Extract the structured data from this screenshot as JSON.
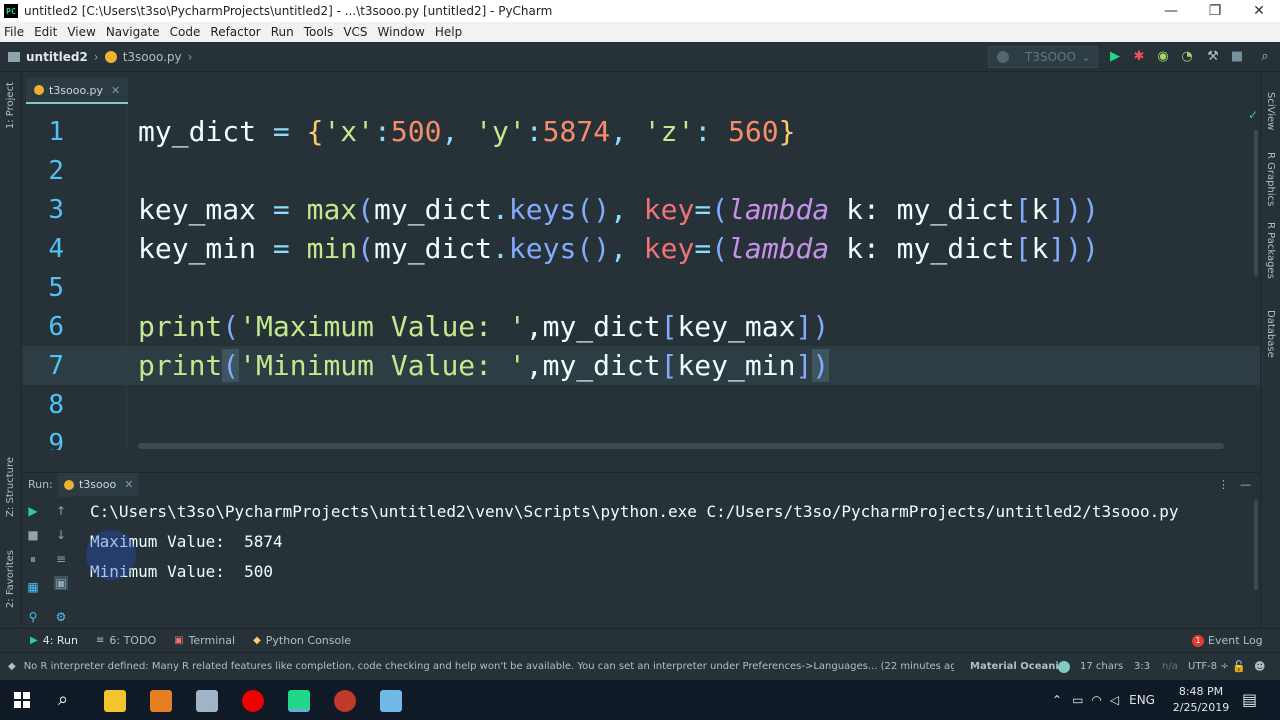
{
  "window": {
    "title": "untitled2 [C:\\Users\\t3so\\PycharmProjects\\untitled2] - ...\\t3sooo.py [untitled2] - PyCharm",
    "logo": "PC",
    "minimize": "—",
    "maximize": "❐",
    "close": "✕"
  },
  "menu": [
    "File",
    "Edit",
    "View",
    "Navigate",
    "Code",
    "Refactor",
    "Run",
    "Tools",
    "VCS",
    "Window",
    "Help"
  ],
  "breadcrumb": {
    "project": "untitled2",
    "file": "t3sooo.py",
    "arrow": "›"
  },
  "run_config": {
    "name": "T3SOOO",
    "dropdown": "⌄"
  },
  "side_labels": {
    "project": "1: Project",
    "structure": "Z: Structure",
    "favorites": "2: Favorites"
  },
  "right_labels": [
    "SciView",
    "R Graphics",
    "R Packages",
    "Database"
  ],
  "editor_tab": {
    "label": "t3sooo.py",
    "close": "✕"
  },
  "code": {
    "line_numbers": [
      "1",
      "2",
      "3",
      "4",
      "5",
      "6",
      "7",
      "8",
      "9"
    ],
    "l1": {
      "name": "my_dict",
      "eq": " = ",
      "open": "{",
      "k1": "'x'",
      "c1": ":",
      "v1": "500",
      "s1": ", ",
      "k2": "'y'",
      "c2": ":",
      "v2": "5874",
      "s2": ", ",
      "k3": "'z'",
      "c3": ": ",
      "v3": "560",
      "close": "}"
    },
    "l3": {
      "name": "key_max",
      "eq": " = ",
      "fn": "max",
      "p1": "(",
      "obj": "my_dict",
      "dot": ".",
      "method": "keys",
      "p2": "()",
      "comma": ", ",
      "kw": "key",
      "eq2": "=",
      "p3": "(",
      "lambda": "lambda",
      "rest": " k: my_dict",
      "b1": "[",
      "k": "k",
      "b2": "]",
      "p4": "))"
    },
    "l4": {
      "name": "key_min",
      "eq": " = ",
      "fn": "min",
      "p1": "(",
      "obj": "my_dict",
      "dot": ".",
      "method": "keys",
      "p2": "()",
      "comma": ", ",
      "kw": "key",
      "eq2": "=",
      "p3": "(",
      "lambda": "lambda",
      "rest": " k: my_dict",
      "b1": "[",
      "k": "k",
      "b2": "]",
      "p4": "))"
    },
    "l6": {
      "fn": "print",
      "p1": "(",
      "str": "'Maximum Value: '",
      "rest": ",my_dict",
      "b1": "[",
      "arg": "key_max",
      "b2": "]",
      "p2": ")"
    },
    "l7": {
      "fn": "print",
      "p1": "(",
      "str": "'Minimum Value: '",
      "rest": ",my_dict",
      "b1": "[",
      "arg": "key_min",
      "b2": "]",
      "p2": ")"
    }
  },
  "run_panel": {
    "label": "Run:",
    "tab": "t3sooo",
    "tab_close": "✕",
    "menu_icon": "⋮",
    "minimize_icon": "—"
  },
  "console": {
    "command": "C:\\Users\\t3so\\PycharmProjects\\untitled2\\venv\\Scripts\\python.exe C:/Users/t3so/PycharmProjects/untitled2/t3sooo.py",
    "out1": "Maximum Value:  5874",
    "out2": "Minimum Value:  500"
  },
  "tool_windows": [
    {
      "icon": "▶",
      "label": "4: Run"
    },
    {
      "icon": "≡",
      "label": "6: TODO"
    },
    {
      "icon": "▣",
      "label": "Terminal"
    },
    {
      "icon": "◆",
      "label": "Python Console"
    }
  ],
  "event_log": {
    "badge": "1",
    "label": "Event Log"
  },
  "status": {
    "message": "No R interpreter defined: Many R related features like completion, code checking and help won't be available. You can set an interpreter under Preferences->Languages... (22 minutes ago)",
    "theme": "Material Oceanic",
    "chars": "17 chars",
    "pos": "3:3",
    "na": "n/a",
    "encoding": "UTF-8 ÷"
  },
  "taskbar": {
    "lang": "ENG",
    "time": "8:48 PM",
    "date": "2/25/2019"
  },
  "colors": {
    "accent": "#80cbc4",
    "line_number": "#4fc3f7",
    "run_green": "#21d789"
  }
}
